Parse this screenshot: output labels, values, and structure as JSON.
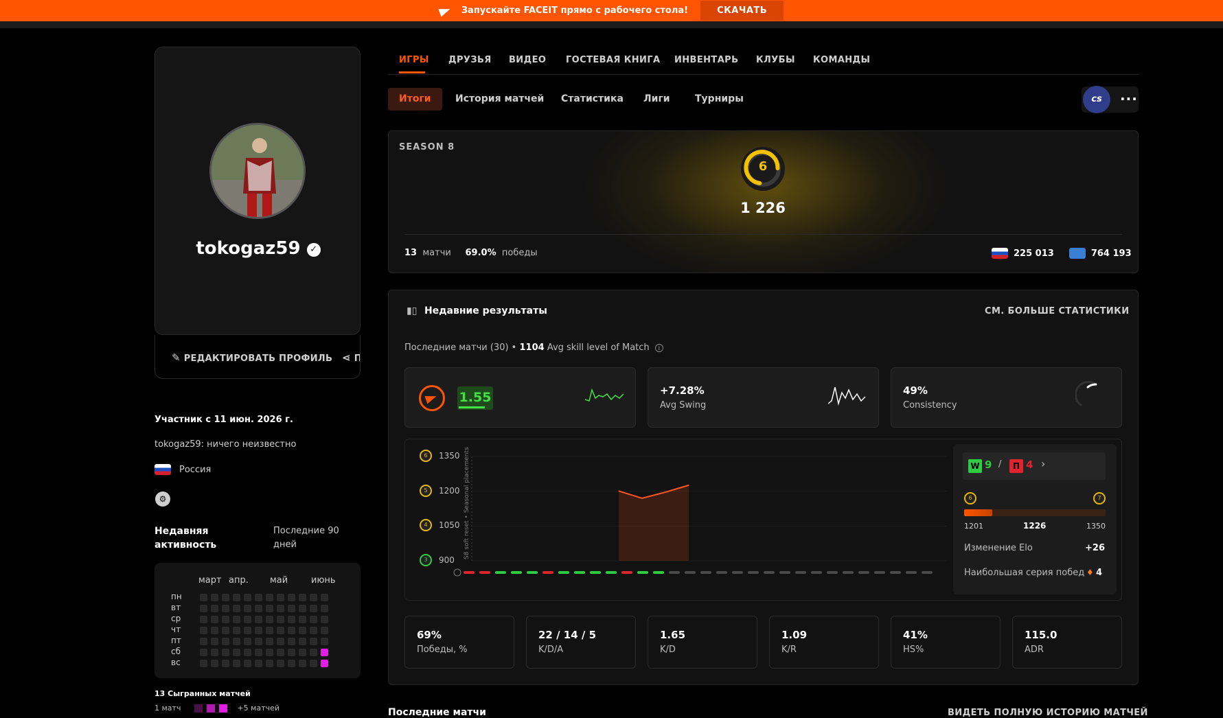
{
  "banner": {
    "text": "Запускайте FACEIT прямо с рабочего стола!",
    "button": "СКАЧАТЬ"
  },
  "profile": {
    "username": "tokogaz59",
    "edit_label": "РЕДАКТИРОВАТЬ ПРОФИЛЬ",
    "share_label": "ПОДЕЛИТЬСЯ",
    "member_since": "Участник с 11 июн. 2026 г.",
    "bio": "tokogaz59: ничего неизвестно",
    "country": "Россия"
  },
  "activity": {
    "title": "Недавняя активность",
    "period": "Последние 90 дней",
    "months": [
      "март",
      "апр.",
      "май",
      "июнь"
    ],
    "weekdays": [
      "пн",
      "вт",
      "ср",
      "чт",
      "пт",
      "сб",
      "вс"
    ],
    "matches_played": "13 Сыгранных матчей",
    "legend_min": "1 матч",
    "legend_max": "+5 матчей"
  },
  "tabs": [
    "ИГРЫ",
    "ДРУЗЬЯ",
    "ВИДЕО",
    "ГОСТЕВАЯ КНИГА",
    "ИНВЕНТАРЬ",
    "КЛУБЫ",
    "КОМАНДЫ"
  ],
  "subtabs": [
    "Итоги",
    "История матчей",
    "Статистика",
    "Лиги",
    "Турниры"
  ],
  "game_badge": "cs",
  "season": {
    "label": "SEASON 8",
    "level": "6",
    "elo": "1 226",
    "matches_value": "13",
    "matches_label": "матчи",
    "wins_value": "69.0%",
    "wins_label": "победы",
    "country_rank": "225 013",
    "region_rank": "764 193"
  },
  "recent": {
    "title": "Недавние результаты",
    "more": "СМ. БОЛЬШЕ СТАТИСТИКИ",
    "matches_info": "Последние матчи (30)",
    "avg_value": "1104",
    "avg_label": "Avg skill level of Match",
    "rating": "1.55",
    "swing_value": "+7.28%",
    "swing_label": "Avg Swing",
    "consistency_value": "49%",
    "consistency_label": "Consistency"
  },
  "chart_data": {
    "type": "line",
    "y_ticks": [
      "1350",
      "1200",
      "1050",
      "900"
    ],
    "y_levels": [
      "6",
      "5",
      "4",
      "3"
    ],
    "axis_note": "S8 soft reset • Seasonal placements",
    "ylim": [
      900,
      1350
    ],
    "x": [
      1,
      2,
      3,
      4
    ],
    "values": [
      1201,
      1170,
      1196,
      1226
    ],
    "results": [
      "L",
      "L",
      "W",
      "W",
      "W",
      "L",
      "W",
      "W",
      "W",
      "W",
      "L",
      "W",
      "W",
      "-",
      "-",
      "-",
      "-",
      "-",
      "-",
      "-",
      "-",
      "-",
      "-",
      "-",
      "-",
      "-",
      "-",
      "-",
      "-",
      "-"
    ],
    "colors": {
      "win": "#2ecc40",
      "loss": "#e0242e",
      "none": "#4a4a4a",
      "line": "#ff5522"
    }
  },
  "summary": {
    "wins": "9",
    "losses": "4",
    "win_letter": "W",
    "loss_letter": "П",
    "level_from": "6",
    "level_to": "7",
    "elo_min": "1201",
    "elo_cur": "1226",
    "elo_max": "1350",
    "elo_progress": 0.2,
    "elo_change_label": "Изменение Elo",
    "elo_change_value": "+26",
    "streak_label": "Наибольшая серия побед",
    "streak_value": "4"
  },
  "stats": [
    {
      "value": "69%",
      "label": "Победы, %"
    },
    {
      "value": "22 / 14 / 5",
      "label": "K/D/A"
    },
    {
      "value": "1.65",
      "label": "K/D"
    },
    {
      "value": "1.09",
      "label": "K/R"
    },
    {
      "value": "41%",
      "label": "HS%"
    },
    {
      "value": "115.0",
      "label": "ADR"
    }
  ],
  "last_matches": {
    "title": "Последние матчи",
    "link": "ВИДЕТЬ ПОЛНУЮ ИСТОРИЮ МАТЧЕЙ"
  }
}
